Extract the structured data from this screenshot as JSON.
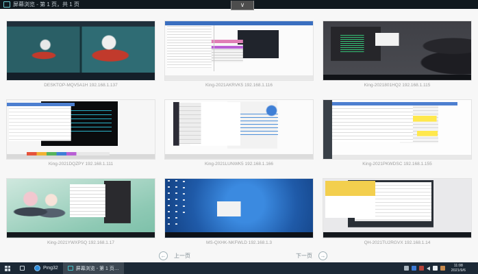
{
  "window": {
    "title": "屏幕浏览 - 第 1 页，共 1 页"
  },
  "toolbar": {
    "collapse_chevron": "∨"
  },
  "grid": {
    "machines": [
      {
        "caption": "DESKTOP-MQV5A1H 192.168.1.137"
      },
      {
        "caption": "King-2021AKRVK5 192.168.1.116"
      },
      {
        "caption": "King-2021801HQ2 192.168.1.115"
      },
      {
        "caption": "King-2021DQZPY 192.168.1.111"
      },
      {
        "caption": "King-2021LUNWK5 192.168.1.166"
      },
      {
        "caption": "King-2021PKWDSC 192.168.1.155"
      },
      {
        "caption": "King-2021YWXPSQ 192.168.1.17"
      },
      {
        "caption": "MS-QXHK-NKFWLD 192.168.1.3"
      },
      {
        "caption": "QH-2021TU2RGVX 192.168.1.14"
      }
    ]
  },
  "pagination": {
    "prev_arrow": "←",
    "prev_label": "上一页",
    "next_label": "下一页",
    "next_arrow": "→"
  },
  "taskbar": {
    "app_label": "Ping32",
    "active_window_label": "屏幕浏览 - 第 1 页…",
    "tray_icons": [
      "grid-icon",
      "app-blue-icon",
      "security-red-icon",
      "speaker-icon",
      "input-method-icon",
      "app-orange-icon"
    ],
    "clock_time": "11:08",
    "clock_date": "2021/9/6"
  },
  "colors": {
    "titlebar_bg": "#10181e",
    "taskbar_bg": "#1c2936",
    "caption_text": "#9e9e9e",
    "highlight_yellow": "#ffe84d"
  }
}
